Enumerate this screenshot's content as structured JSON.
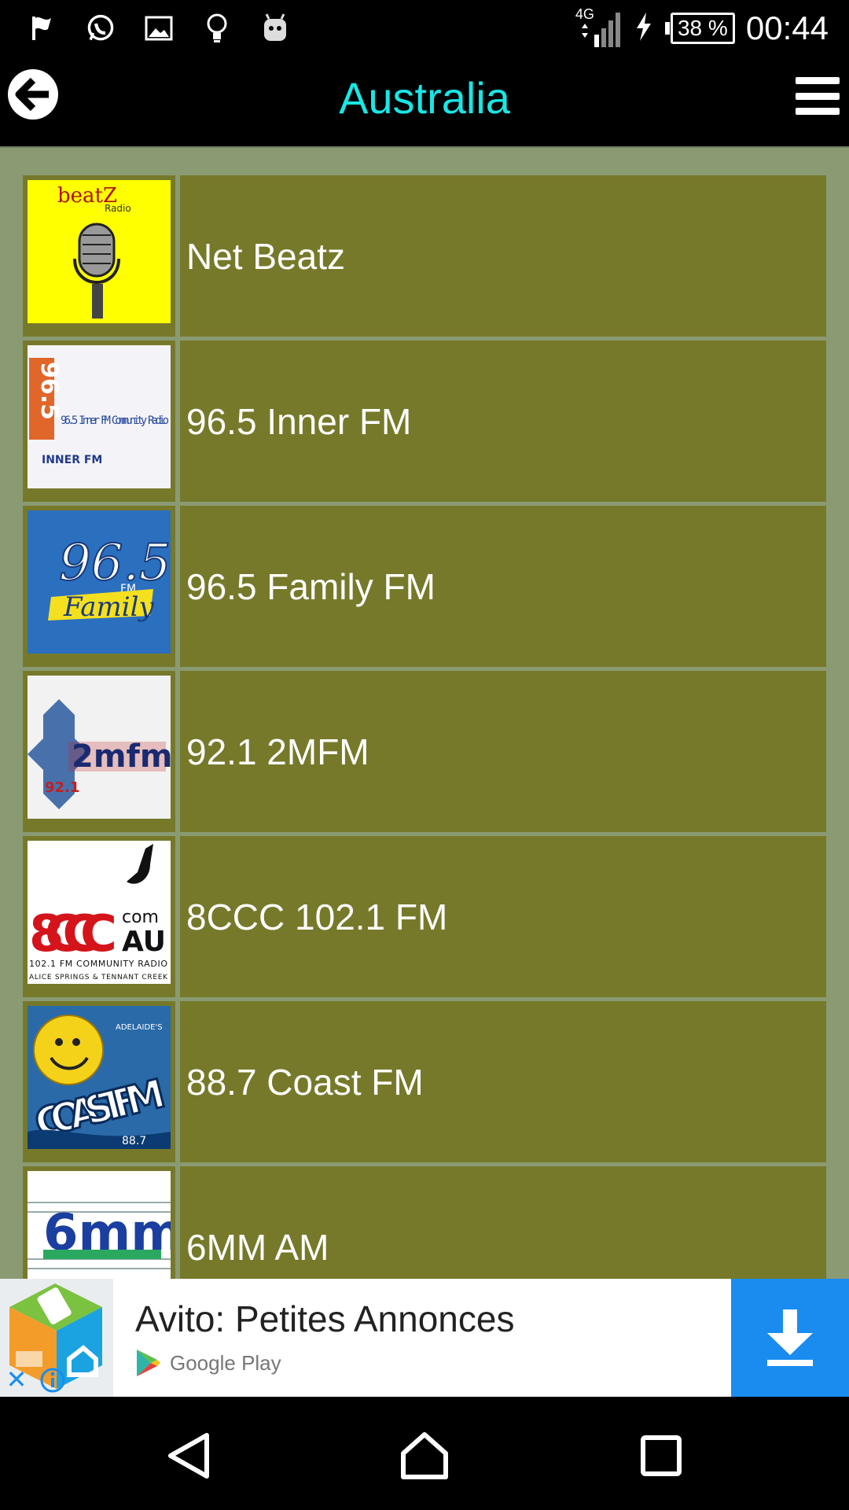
{
  "status_bar": {
    "network": "4G",
    "battery": "38 %",
    "time": "00:44",
    "icons": [
      "flag-icon",
      "whatsapp-icon",
      "image-icon",
      "lightbulb-icon",
      "android-icon"
    ]
  },
  "app_bar": {
    "title": "Australia",
    "title_color": "#19e6e6"
  },
  "stations": [
    {
      "name": "Net Beatz",
      "logo": "beatz-radio-logo",
      "logo_text": "beatz Radio"
    },
    {
      "name": "96.5 Inner FM",
      "logo": "inner-fm-logo",
      "logo_text": "96.5 Inner FM Community Radio"
    },
    {
      "name": "96.5 Family FM",
      "logo": "family-fm-logo",
      "logo_text": "96.5 FM Family"
    },
    {
      "name": "92.1 2MFM",
      "logo": "2mfm-logo",
      "logo_text": "92.1 2mfm"
    },
    {
      "name": "8CCC 102.1 FM",
      "logo": "8ccc-logo",
      "logo_text": "8CCC com AU 102.1 FM COMMUNITY RADIO ALICE SPRINGS & TENNANT CREEK"
    },
    {
      "name": "88.7 Coast FM",
      "logo": "coast-fm-logo",
      "logo_text": "ADELAIDE'S COAST FM 88.7"
    },
    {
      "name": "6MM AM",
      "logo": "6mm-logo",
      "logo_text": "6mm"
    }
  ],
  "ad": {
    "title": "Avito: Petites Annonces",
    "store": "Google Play",
    "accent": "#1a8cf0"
  },
  "colors": {
    "row_bg": "#76792a",
    "page_bg": "#8a9a72"
  }
}
